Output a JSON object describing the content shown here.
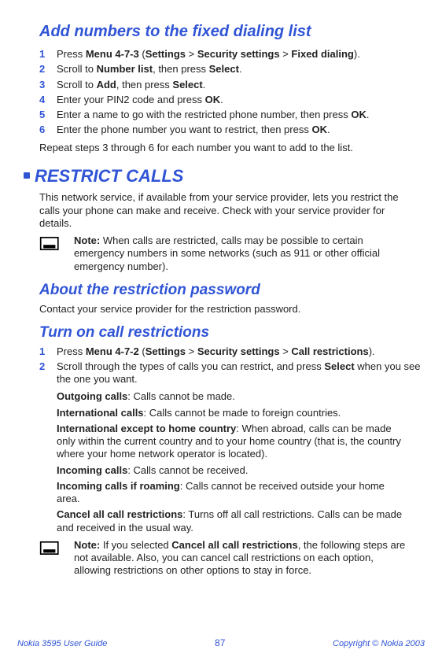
{
  "heading_add_numbers": "Add numbers to the fixed dialing list",
  "steps_fixed": [
    {
      "n": "1",
      "pre": "Press ",
      "b1": "Menu 4-7-3",
      "mid": " (",
      "b2": "Settings",
      "sep1": " > ",
      "b3": "Security settings",
      "sep2": " > ",
      "b4": "Fixed dialing",
      "post": ")."
    },
    {
      "n": "2",
      "pre": "Scroll to ",
      "b1": "Number list",
      "mid": ", then press ",
      "b2": "Select",
      "post": "."
    },
    {
      "n": "3",
      "pre": "Scroll to ",
      "b1": "Add",
      "mid": ", then press ",
      "b2": "Select",
      "post": "."
    },
    {
      "n": "4",
      "pre": "Enter your PIN2 code and press ",
      "b1": "OK",
      "post": "."
    },
    {
      "n": "5",
      "pre": "Enter a name to go with the restricted phone number, then press ",
      "b1": "OK",
      "post": "."
    },
    {
      "n": "6",
      "pre": "Enter the phone number you want to restrict, then press ",
      "b1": "OK",
      "post": "."
    }
  ],
  "repeat_text": "Repeat steps 3 through 6 for each number you want to add to the list.",
  "heading_restrict": "RESTRICT CALLS",
  "restrict_intro": "This network service, if available from your service provider, lets you restrict the calls your phone can make and receive. Check with your service provider for details.",
  "note1_label": "Note:",
  "note1_text": " When calls are restricted, calls may be possible to certain emergency numbers in some networks (such as 911 or other official emergency number).",
  "heading_about": "About the restriction password",
  "about_text": "Contact your service provider for the restriction password.",
  "heading_turnon": "Turn on call restrictions",
  "steps_turnon": [
    {
      "n": "1",
      "pre": "Press ",
      "b1": "Menu 4-7-2",
      "mid": " (",
      "b2": "Settings",
      "sep1": " > ",
      "b3": "Security settings",
      "sep2": " > ",
      "b4": "Call restrictions",
      "post": ")."
    },
    {
      "n": "2",
      "pre": "Scroll through the types of calls you can restrict, and press ",
      "b1": "Select",
      "post": " when you see the one you want."
    }
  ],
  "call_types": [
    {
      "b": "Outgoing calls",
      "t": ": Calls cannot be made."
    },
    {
      "b": "International calls",
      "t": ": Calls cannot be made to foreign countries."
    },
    {
      "b": "International except to home country",
      "t": ": When abroad, calls can be made only within the current country and to your home country (that is, the country where your home network operator is located)."
    },
    {
      "b": "Incoming calls",
      "t": ": Calls cannot be received."
    },
    {
      "b": "Incoming calls if roaming",
      "t": ": Calls cannot be received outside your home area."
    },
    {
      "b": "Cancel all call restrictions",
      "t": ": Turns off all call restrictions. Calls can be made and received in the usual way."
    }
  ],
  "note2_label": "Note:",
  "note2_pre": " If you selected ",
  "note2_b": "Cancel all call restrictions",
  "note2_post": ", the following steps are not available. Also, you can cancel call restrictions on each option, allowing restrictions on other options to stay in force.",
  "footer_left": "Nokia 3595 User Guide",
  "footer_page": "87",
  "footer_right": "Copyright © Nokia 2003"
}
